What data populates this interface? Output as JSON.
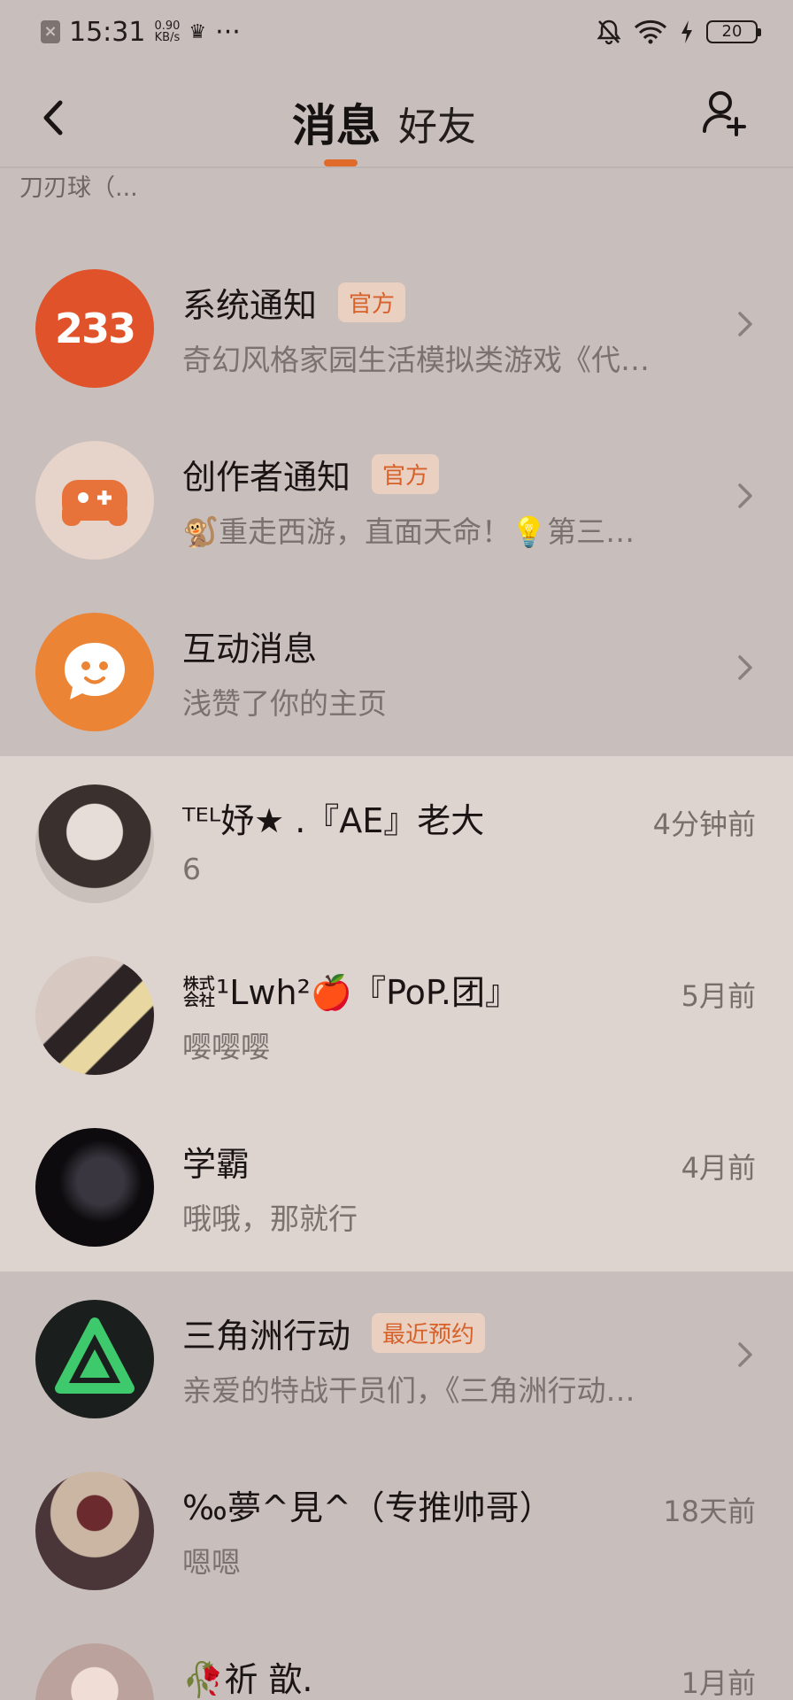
{
  "status_bar": {
    "time": "15:31",
    "speed_value": "0.90",
    "speed_unit": "KB/s",
    "more": "···",
    "battery": "20"
  },
  "header": {
    "tab_messages": "消息",
    "tab_friends": "好友",
    "truncated_name": "刀刃球（..."
  },
  "rows": [
    {
      "title": "系统通知",
      "badge": "官方",
      "subtitle": "奇幻风格家园生活模拟类游戏《代…",
      "avatar_text": "233"
    },
    {
      "title": "创作者通知",
      "badge": "官方",
      "subtitle": "🐒重走西游，直面天命！💡第三…"
    },
    {
      "title": "互动消息",
      "subtitle": "浅赞了你的主页"
    },
    {
      "title": "ᵀᴱᴸ妤★ .『AE』老大",
      "subtitle": "6",
      "time": "4分钟前"
    },
    {
      "title": "㍿¹Lwh²🍎『PoP.团』",
      "subtitle": "嘤嘤嘤",
      "time": "5月前"
    },
    {
      "title": "学霸",
      "subtitle": "哦哦，那就行",
      "time": "4月前"
    },
    {
      "title": "三角洲行动",
      "badge": "最近预约",
      "subtitle": "亲爱的特战干员们，《三角洲行动…"
    },
    {
      "title": "‰夢^見^（专推帅哥）",
      "subtitle": "嗯嗯",
      "time": "18天前"
    },
    {
      "title": "🥀祈 歆.",
      "time": "1月前"
    }
  ],
  "colors": {
    "accent": "#e06a2a",
    "badge_bg": "#ead0c1",
    "system_avatar": "#e0532a",
    "interaction_avatar": "#ec8436"
  }
}
